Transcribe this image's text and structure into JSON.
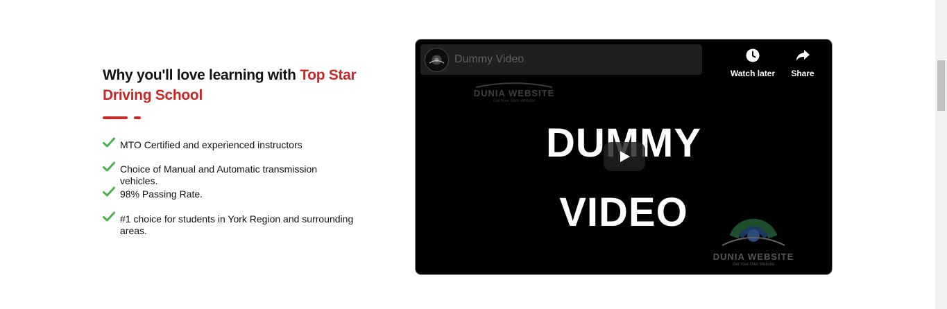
{
  "section": {
    "heading_plain": "Why you'll love learning with ",
    "heading_accent": "Top Star Driving School",
    "accent_color": "#c62828",
    "check_color": "#4caf50",
    "features": [
      {
        "text": "MTO Certified and experienced instructors",
        "icon": "check-icon"
      },
      {
        "text": "Choice of Manual and Automatic transmission vehicles.",
        "icon": "check-icon"
      },
      {
        "text": "98% Passing Rate.",
        "icon": "check-icon"
      },
      {
        "text": "#1 choice for students in York Region and surrounding areas.",
        "icon": "check-icon"
      }
    ]
  },
  "video": {
    "title": "Dummy Video",
    "watch_later_label": "Watch later",
    "share_label": "Share",
    "thumbnail_line1": "DUMMY",
    "thumbnail_line2": "VIDEO",
    "watermark_name": "DUNIA WEBSITE",
    "watermark_tagline": "Get Your Own Website",
    "icons": {
      "watch_later": "clock-icon",
      "share": "share-arrow-icon",
      "play": "play-icon"
    }
  }
}
